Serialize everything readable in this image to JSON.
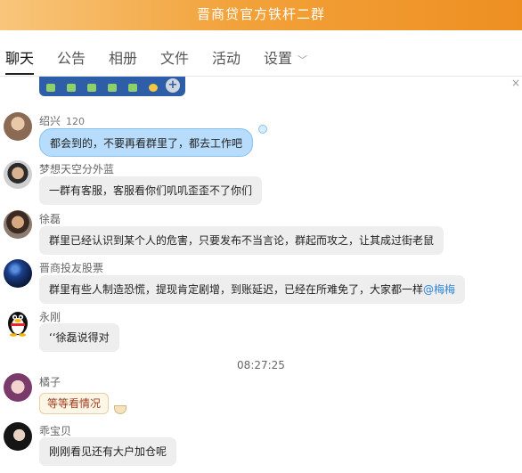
{
  "window": {
    "title": "晋商贷官方铁杆二群"
  },
  "tabs": [
    {
      "label": "聊天",
      "active": true
    },
    {
      "label": "公告"
    },
    {
      "label": "相册"
    },
    {
      "label": "文件"
    },
    {
      "label": "活动"
    },
    {
      "label": "设置"
    }
  ],
  "icons": {
    "close": "×",
    "chevron": "﹀",
    "plus": "+"
  },
  "colors": {
    "title_gradient_start": "#f8c67b",
    "title_gradient_end": "#ee8f22",
    "emoji_bar": "#2f5ea8",
    "blue_bubble": "#b8dcfb",
    "gray_bubble": "#eeeeee",
    "mention": "#2e86d6"
  },
  "messages": [
    {
      "name": "绍兴",
      "level": "120",
      "text": "都会到的，不要再看群里了，都去工作吧",
      "style": "blue"
    },
    {
      "name": "梦想天空分外蓝",
      "text": "一群有客服，客服看你们叽叽歪歪不了你们",
      "style": "gray"
    },
    {
      "name": "徐磊",
      "text": "群里已经认识到某个人的危害，只要发布不当言论，群起而攻之，让其成过街老鼠",
      "style": "gray"
    },
    {
      "name": "晋商投友股票",
      "text": "群里有些人制造恐慌，提现肯定剧增，到账延迟，已经在所难免了，大家都一样",
      "mention": "@梅梅",
      "style": "gray"
    },
    {
      "name": "永刚",
      "text": "‘‘徐磊说得对",
      "style": "gray"
    },
    {
      "name": "橘子",
      "text": "等等看情况",
      "style": "cream"
    },
    {
      "name": "乖宝贝",
      "text": "刚刚看见还有大户加仓呢",
      "style": "gray"
    }
  ],
  "timestamp": "08:27:25"
}
